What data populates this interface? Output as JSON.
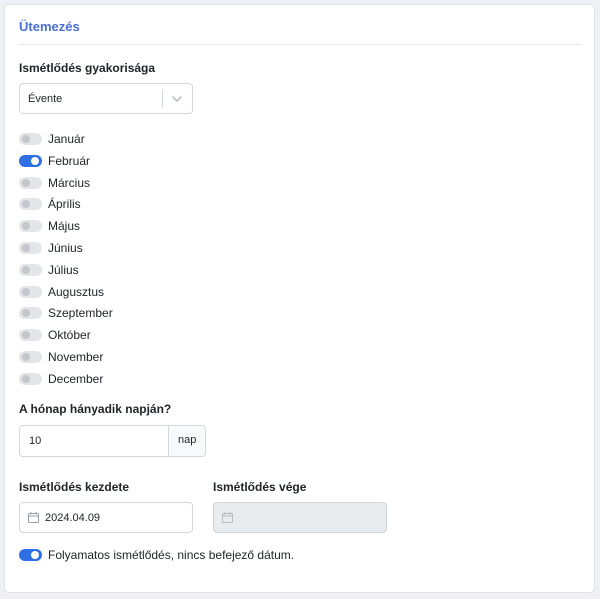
{
  "card": {
    "title": "Ütemezés"
  },
  "frequency": {
    "label": "Ismétlődés gyakorisága",
    "selected": "Évente",
    "icon": "chevron-down-icon"
  },
  "months": [
    {
      "label": "Január",
      "on": false
    },
    {
      "label": "Február",
      "on": true
    },
    {
      "label": "Március",
      "on": false
    },
    {
      "label": "Április",
      "on": false
    },
    {
      "label": "Május",
      "on": false
    },
    {
      "label": "Június",
      "on": false
    },
    {
      "label": "Július",
      "on": false
    },
    {
      "label": "Augusztus",
      "on": false
    },
    {
      "label": "Szeptember",
      "on": false
    },
    {
      "label": "Október",
      "on": false
    },
    {
      "label": "November",
      "on": false
    },
    {
      "label": "December",
      "on": false
    }
  ],
  "day": {
    "label": "A hónap hányadik napján?",
    "value": "10",
    "unit": "nap"
  },
  "start": {
    "label": "Ismétlődés kezdete",
    "value": "2024.04.09",
    "icon": "calendar-icon"
  },
  "end": {
    "label": "Ismétlődés vége",
    "value": "",
    "icon": "calendar-icon"
  },
  "continuous": {
    "label": "Folyamatos ismétlődés, nincs befejező dátum.",
    "on": true
  },
  "colors": {
    "accent": "#2f6fe4",
    "title": "#4a6fd6"
  }
}
